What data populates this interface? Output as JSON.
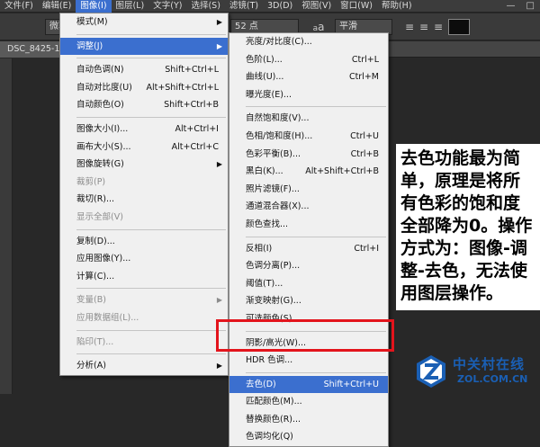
{
  "menubar": {
    "items": [
      "文件(F)",
      "编辑(E)",
      "图像(I)",
      "图层(L)",
      "文字(Y)",
      "选择(S)",
      "滤镜(T)",
      "3D(D)",
      "视图(V)",
      "窗口(W)",
      "帮助(H)"
    ],
    "window_controls": [
      "—",
      "□"
    ]
  },
  "options": {
    "font_family_value": "微软雅",
    "font_size_value": "52 点",
    "aa_label": "a",
    "aa_value": "平滑"
  },
  "doc_tab": "DSC_8425-1",
  "image_menu": {
    "items": [
      {
        "label": "模式(M)",
        "shortcut": "",
        "arrow": true,
        "disabled": false,
        "highlight": false,
        "sep_after": true
      },
      {
        "label": "调整(J)",
        "shortcut": "",
        "arrow": true,
        "disabled": false,
        "highlight": true,
        "sep_after": true
      },
      {
        "label": "自动色调(N)",
        "shortcut": "Shift+Ctrl+L",
        "arrow": false,
        "disabled": false,
        "highlight": false,
        "sep_after": false
      },
      {
        "label": "自动对比度(U)",
        "shortcut": "Alt+Shift+Ctrl+L",
        "arrow": false,
        "disabled": false,
        "highlight": false,
        "sep_after": false
      },
      {
        "label": "自动颜色(O)",
        "shortcut": "Shift+Ctrl+B",
        "arrow": false,
        "disabled": false,
        "highlight": false,
        "sep_after": true
      },
      {
        "label": "图像大小(I)...",
        "shortcut": "Alt+Ctrl+I",
        "arrow": false,
        "disabled": false,
        "highlight": false,
        "sep_after": false
      },
      {
        "label": "画布大小(S)...",
        "shortcut": "Alt+Ctrl+C",
        "arrow": false,
        "disabled": false,
        "highlight": false,
        "sep_after": false
      },
      {
        "label": "图像旋转(G)",
        "shortcut": "",
        "arrow": true,
        "disabled": false,
        "highlight": false,
        "sep_after": false
      },
      {
        "label": "裁剪(P)",
        "shortcut": "",
        "arrow": false,
        "disabled": true,
        "highlight": false,
        "sep_after": false
      },
      {
        "label": "裁切(R)...",
        "shortcut": "",
        "arrow": false,
        "disabled": false,
        "highlight": false,
        "sep_after": false
      },
      {
        "label": "显示全部(V)",
        "shortcut": "",
        "arrow": false,
        "disabled": true,
        "highlight": false,
        "sep_after": true
      },
      {
        "label": "复制(D)...",
        "shortcut": "",
        "arrow": false,
        "disabled": false,
        "highlight": false,
        "sep_after": false
      },
      {
        "label": "应用图像(Y)...",
        "shortcut": "",
        "arrow": false,
        "disabled": false,
        "highlight": false,
        "sep_after": false
      },
      {
        "label": "计算(C)...",
        "shortcut": "",
        "arrow": false,
        "disabled": false,
        "highlight": false,
        "sep_after": true
      },
      {
        "label": "变量(B)",
        "shortcut": "",
        "arrow": true,
        "disabled": true,
        "highlight": false,
        "sep_after": false
      },
      {
        "label": "应用数据组(L)...",
        "shortcut": "",
        "arrow": false,
        "disabled": true,
        "highlight": false,
        "sep_after": true
      },
      {
        "label": "陷印(T)...",
        "shortcut": "",
        "arrow": false,
        "disabled": true,
        "highlight": false,
        "sep_after": true
      },
      {
        "label": "分析(A)",
        "shortcut": "",
        "arrow": true,
        "disabled": false,
        "highlight": false,
        "sep_after": false
      }
    ]
  },
  "adjust_menu": {
    "items": [
      {
        "label": "亮度/对比度(C)...",
        "shortcut": "",
        "highlight": false,
        "sep_after": false
      },
      {
        "label": "色阶(L)...",
        "shortcut": "Ctrl+L",
        "highlight": false,
        "sep_after": false
      },
      {
        "label": "曲线(U)...",
        "shortcut": "Ctrl+M",
        "highlight": false,
        "sep_after": false
      },
      {
        "label": "曝光度(E)...",
        "shortcut": "",
        "highlight": false,
        "sep_after": true
      },
      {
        "label": "自然饱和度(V)...",
        "shortcut": "",
        "highlight": false,
        "sep_after": false
      },
      {
        "label": "色相/饱和度(H)...",
        "shortcut": "Ctrl+U",
        "highlight": false,
        "sep_after": false
      },
      {
        "label": "色彩平衡(B)...",
        "shortcut": "Ctrl+B",
        "highlight": false,
        "sep_after": false
      },
      {
        "label": "黑白(K)...",
        "shortcut": "Alt+Shift+Ctrl+B",
        "highlight": false,
        "sep_after": false
      },
      {
        "label": "照片滤镜(F)...",
        "shortcut": "",
        "highlight": false,
        "sep_after": false
      },
      {
        "label": "通道混合器(X)...",
        "shortcut": "",
        "highlight": false,
        "sep_after": false
      },
      {
        "label": "颜色查找...",
        "shortcut": "",
        "highlight": false,
        "sep_after": true
      },
      {
        "label": "反相(I)",
        "shortcut": "Ctrl+I",
        "highlight": false,
        "sep_after": false
      },
      {
        "label": "色调分离(P)...",
        "shortcut": "",
        "highlight": false,
        "sep_after": false
      },
      {
        "label": "阈值(T)...",
        "shortcut": "",
        "highlight": false,
        "sep_after": false
      },
      {
        "label": "渐变映射(G)...",
        "shortcut": "",
        "highlight": false,
        "sep_after": false
      },
      {
        "label": "可选颜色(S)...",
        "shortcut": "",
        "highlight": false,
        "sep_after": true
      },
      {
        "label": "阴影/高光(W)...",
        "shortcut": "",
        "highlight": false,
        "sep_after": false
      },
      {
        "label": "HDR 色调...",
        "shortcut": "",
        "highlight": false,
        "sep_after": true
      },
      {
        "label": "去色(D)",
        "shortcut": "Shift+Ctrl+U",
        "highlight": true,
        "sep_after": false
      },
      {
        "label": "匹配颜色(M)...",
        "shortcut": "",
        "highlight": false,
        "sep_after": false
      },
      {
        "label": "替换颜色(R)...",
        "shortcut": "",
        "highlight": false,
        "sep_after": false
      },
      {
        "label": "色调均化(Q)",
        "shortcut": "",
        "highlight": false,
        "sep_after": false
      }
    ]
  },
  "caption": "去色功能最为简单，原理是将所有色彩的饱和度全部降为0。操作方式为：图像-调整-去色，无法使用图层操作。",
  "watermark": {
    "name": "中关村在线",
    "url": "ZOL.COM.CN"
  },
  "colors": {
    "highlight": "#3b6fcf",
    "red_box": "#e3141c",
    "watermark": "#1a5fb4"
  }
}
